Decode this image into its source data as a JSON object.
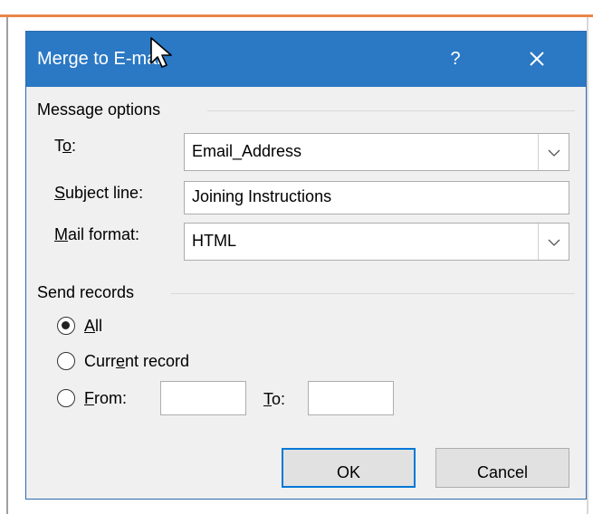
{
  "dialog": {
    "title": "Merge to E-mail",
    "help_glyph": "?",
    "close_icon": "close-icon"
  },
  "message_options": {
    "group_label": "Message options",
    "to": {
      "label_prefix": "T",
      "label_underlined": "o",
      "label_suffix": ":",
      "value": "Email_Address"
    },
    "subject": {
      "label_underlined": "S",
      "label_suffix": "ubject line:",
      "value": "Joining Instructions"
    },
    "mail_format": {
      "label_underlined": "M",
      "label_suffix": "ail format:",
      "value": "HTML"
    }
  },
  "send_records": {
    "group_label": "Send records",
    "options": {
      "all": {
        "label_underlined": "A",
        "label_suffix": "ll",
        "checked": true
      },
      "current": {
        "label_prefix": "Curr",
        "label_underlined": "e",
        "label_suffix": "nt record",
        "checked": false
      },
      "from": {
        "label_underlined": "F",
        "label_suffix": "rom:",
        "checked": false,
        "from_value": "",
        "to_label_underlined": "T",
        "to_label_suffix": "o:",
        "to_value": ""
      }
    }
  },
  "buttons": {
    "ok": "OK",
    "cancel": "Cancel"
  },
  "colors": {
    "titlebar": "#2b78c4",
    "dialog_background": "#f0f0f0",
    "default_button_border": "#0078d7",
    "top_accent": "#e8874a"
  },
  "cursor_icon": "mouse-pointer-icon"
}
